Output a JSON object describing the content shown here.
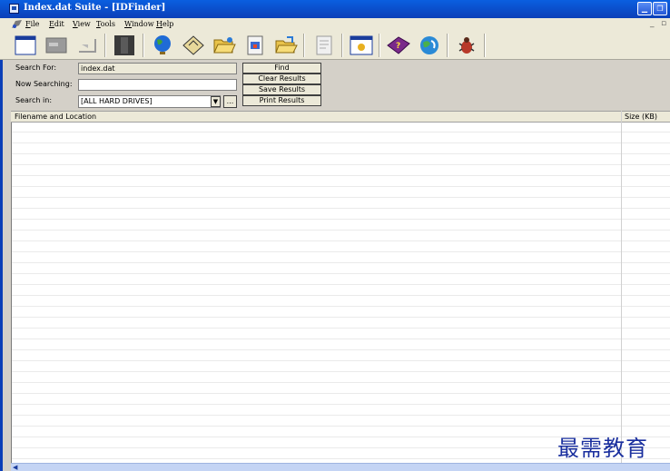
{
  "window": {
    "title": "Index.dat Suite - [IDFinder]"
  },
  "menu": [
    "File",
    "Edit",
    "View",
    "Tools",
    "Window",
    "Help"
  ],
  "search": {
    "search_for_label": "Search For:",
    "search_for_value": "index.dat",
    "now_searching_label": "Now Searching:",
    "now_searching_value": "",
    "search_in_label": "Search in:",
    "search_in_value": "[ALL HARD DRIVES]",
    "browse_label": "..."
  },
  "buttons": {
    "find": "Find",
    "clear": "Clear Results",
    "save": "Save Results",
    "print": "Print Results"
  },
  "columns": {
    "filename": "Filename and Location",
    "size": "Size (KB)"
  },
  "watermark": "最需教育",
  "colors": {
    "title_bar": "#0b3fb8",
    "face": "#d4d0c8",
    "toolbar": "#ece9d8"
  },
  "toolbar_icons": [
    "window-icon",
    "console-icon",
    "flag-icon",
    "dark-panel-icon",
    "globe-icon",
    "disk-icon",
    "folder-open-icon",
    "document-icon",
    "folder-icon",
    "notepad-icon",
    "image-icon",
    "help-book-icon",
    "ie-globe-icon",
    "bug-icon"
  ]
}
